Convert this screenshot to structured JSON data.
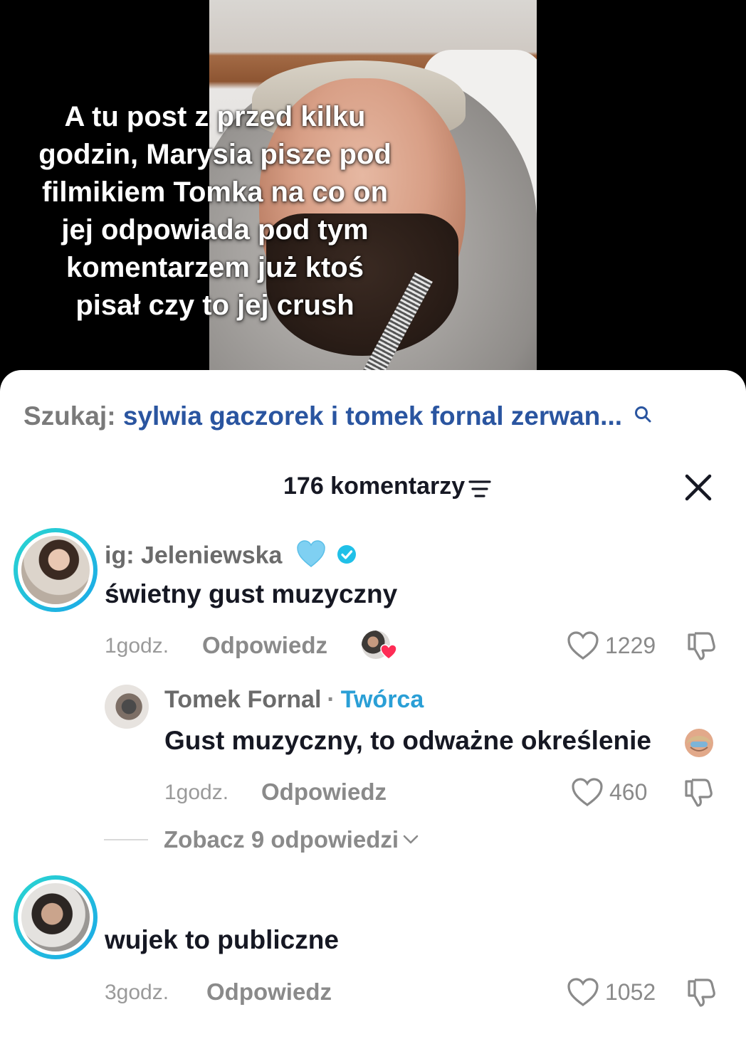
{
  "video": {
    "caption": "A tu post z przed kilku\ngodzin, Marysia pisze pod\nfilmikiem Tomka na co on\njej odpowiada pod tym\nkomentarzem już ktoś\npisał czy to jej crush"
  },
  "search": {
    "label": "Szukaj:",
    "query": "sylwia gaczorek i tomek fornal zerwan...",
    "icon": "search-icon",
    "colors": {
      "label": "#7a7a7a",
      "query": "#2a55a0"
    }
  },
  "header": {
    "count_label": "176 komentarzy",
    "sort_icon": "sort-icon",
    "close_icon": "close-icon"
  },
  "comments": [
    {
      "username": "ig: Jeleniewska",
      "username_emoji": "light-blue-heart",
      "verified": true,
      "text": "świetny gust muzyczny",
      "time": "1godz.",
      "reply_label": "Odpowiedz",
      "liked_by_creator": true,
      "likes": "1229"
    },
    {
      "username": "Tomek Fornal",
      "separator": "·",
      "role": "Twórca",
      "text": "Gust muzyczny, to odważne określenie",
      "text_emoji": "person-facepalming",
      "time": "1godz.",
      "reply_label": "Odpowiedz",
      "likes": "460"
    },
    {
      "text": "wujek to publiczne",
      "time": "3godz.",
      "reply_label": "Odpowiedz",
      "likes": "1052"
    }
  ],
  "view_replies": {
    "label": "Zobacz 9 odpowiedzi"
  },
  "colors": {
    "accent_creator": "#2a9fd6",
    "ring": "#1fc3dc",
    "text": "#161823",
    "muted": "#8a8a8a"
  }
}
